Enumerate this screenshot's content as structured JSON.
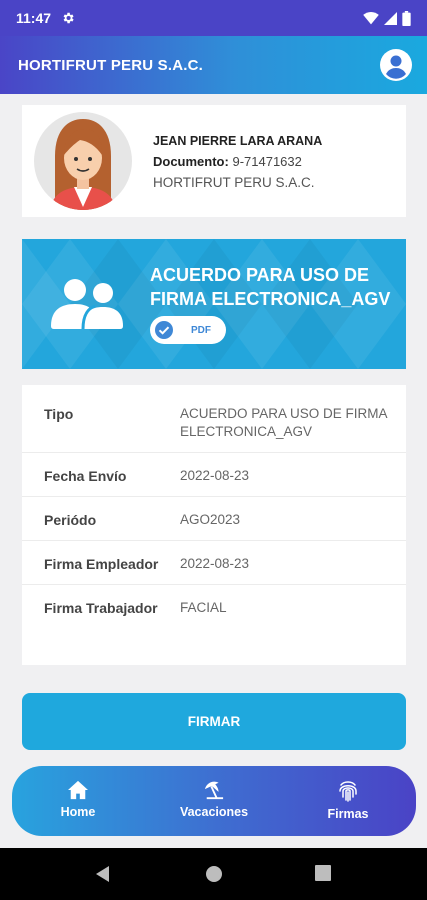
{
  "status_bar": {
    "time": "11:47"
  },
  "app_bar": {
    "title": "HORTIFRUT PERU S.A.C."
  },
  "profile": {
    "name": "JEAN PIERRE LARA ARANA",
    "document_label": "Documento:",
    "document_value": "9-71471632",
    "company": "HORTIFRUT PERU S.A.C."
  },
  "banner": {
    "title": "ACUERDO PARA USO DE FIRMA ELECTRONICA_AGV",
    "pdf_label": "PDF"
  },
  "details": [
    {
      "label": "Tipo",
      "value": "ACUERDO PARA USO DE FIRMA ELECTRONICA_AGV"
    },
    {
      "label": "Fecha Envío",
      "value": "2022-08-23"
    },
    {
      "label": "Periódo",
      "value": "AGO2023"
    },
    {
      "label": "Firma Empleador",
      "value": "2022-08-23"
    },
    {
      "label": "Firma Trabajador",
      "value": "FACIAL"
    }
  ],
  "sign_button": "FIRMAR",
  "bottom_nav": {
    "items": [
      {
        "label": "Home",
        "icon": "home-icon"
      },
      {
        "label": "Vacaciones",
        "icon": "umbrella-beach-icon"
      },
      {
        "label": "Firmas",
        "icon": "fingerprint-icon"
      }
    ]
  },
  "colors": {
    "primary_purple": "#4a44c6",
    "accent_blue": "#1fa8dd",
    "banner_blue": "#23a6dc"
  }
}
